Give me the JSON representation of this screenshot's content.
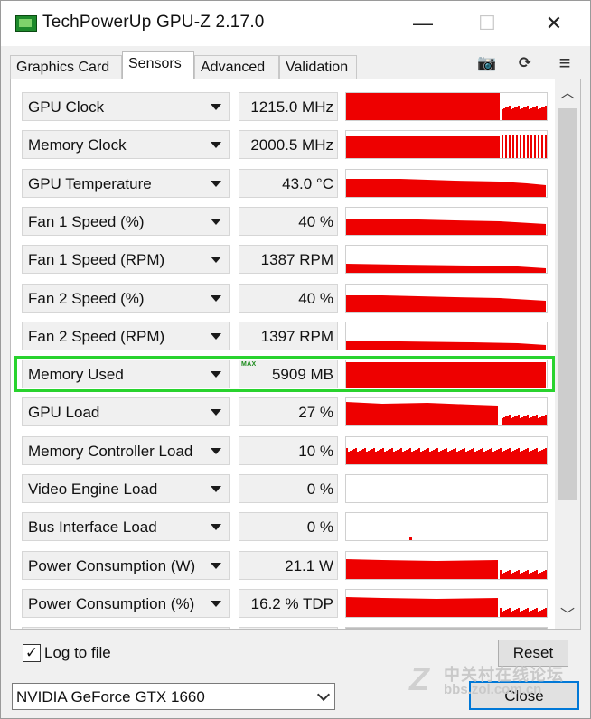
{
  "window": {
    "title": "TechPowerUp GPU-Z 2.17.0",
    "minimize_glyph": "—",
    "maximize_glyph": "☐",
    "close_glyph": "✕"
  },
  "tabs": [
    {
      "label": "Graphics Card",
      "active": false
    },
    {
      "label": "Sensors",
      "active": true
    },
    {
      "label": "Advanced",
      "active": false
    },
    {
      "label": "Validation",
      "active": false
    }
  ],
  "toolbar": {
    "icons": [
      "camera-icon",
      "refresh-icon",
      "menu-icon"
    ],
    "camera_glyph": "📷",
    "refresh_glyph": "⟳",
    "menu_glyph": "≡"
  },
  "sensors": [
    {
      "name": "GPU Clock",
      "value": "1215.0 MHz",
      "tag": "",
      "graph": "clock"
    },
    {
      "name": "Memory Clock",
      "value": "2000.5 MHz",
      "tag": "",
      "graph": "memclock"
    },
    {
      "name": "GPU Temperature",
      "value": "43.0 °C",
      "tag": "",
      "graph": "temp"
    },
    {
      "name": "Fan 1 Speed (%)",
      "value": "40 %",
      "tag": "",
      "graph": "fanpct"
    },
    {
      "name": "Fan 1 Speed (RPM)",
      "value": "1387 RPM",
      "tag": "",
      "graph": "fanrpm"
    },
    {
      "name": "Fan 2 Speed (%)",
      "value": "40 %",
      "tag": "",
      "graph": "fanpct"
    },
    {
      "name": "Fan 2 Speed (RPM)",
      "value": "1397 RPM",
      "tag": "",
      "graph": "fanrpm"
    },
    {
      "name": "Memory Used",
      "value": "5909 MB",
      "tag": "MAX",
      "graph": "full"
    },
    {
      "name": "GPU Load",
      "value": "27 %",
      "tag": "",
      "graph": "load"
    },
    {
      "name": "Memory Controller Load",
      "value": "10 %",
      "tag": "",
      "graph": "mcload"
    },
    {
      "name": "Video Engine Load",
      "value": "0 %",
      "tag": "",
      "graph": "empty"
    },
    {
      "name": "Bus Interface Load",
      "value": "0 %",
      "tag": "",
      "graph": "bus"
    },
    {
      "name": "Power Consumption (W)",
      "value": "21.1 W",
      "tag": "",
      "graph": "power"
    },
    {
      "name": "Power Consumption (%)",
      "value": "16.2 % TDP",
      "tag": "",
      "graph": "power"
    },
    {
      "name": "",
      "value": "",
      "tag": "",
      "graph": "partial"
    }
  ],
  "colors": {
    "graph_fill": "#ee0000",
    "highlight": "#29d32e"
  },
  "footer": {
    "log_label": "Log to file",
    "log_checked": "✓",
    "reset_label": "Reset",
    "close_label": "Close",
    "gpu_selected": "NVIDIA GeForce GTX 1660"
  },
  "watermark": {
    "logo": "Z",
    "text": "中关村在线论坛",
    "url": "bbs.zol.com.cn"
  }
}
